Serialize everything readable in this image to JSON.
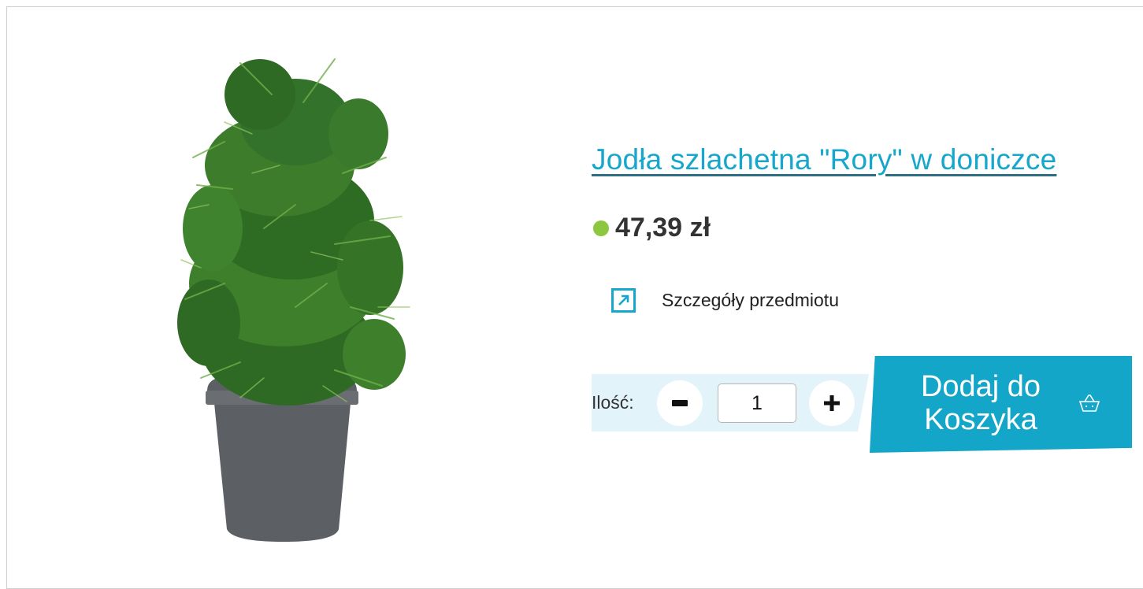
{
  "product": {
    "title": "Jodła szlachetna \"Rory\" w doniczce",
    "price": "47,39 zł",
    "availability_color": "#8dc63f",
    "details_label": "Szczegóły przedmiotu",
    "details_icon": "external-link-arrow-icon",
    "image_icon": "potted-fir-tree-image"
  },
  "quantity": {
    "label": "Ilość:",
    "value": "1",
    "decrease_icon": "minus-icon",
    "increase_icon": "plus-icon"
  },
  "cart": {
    "label_line1": "Dodaj do",
    "label_line2": "Koszyka",
    "icon": "basket-icon"
  },
  "colors": {
    "accent": "#13a6c8",
    "quantity_background": "#e3f3fa",
    "text": "#333333"
  }
}
